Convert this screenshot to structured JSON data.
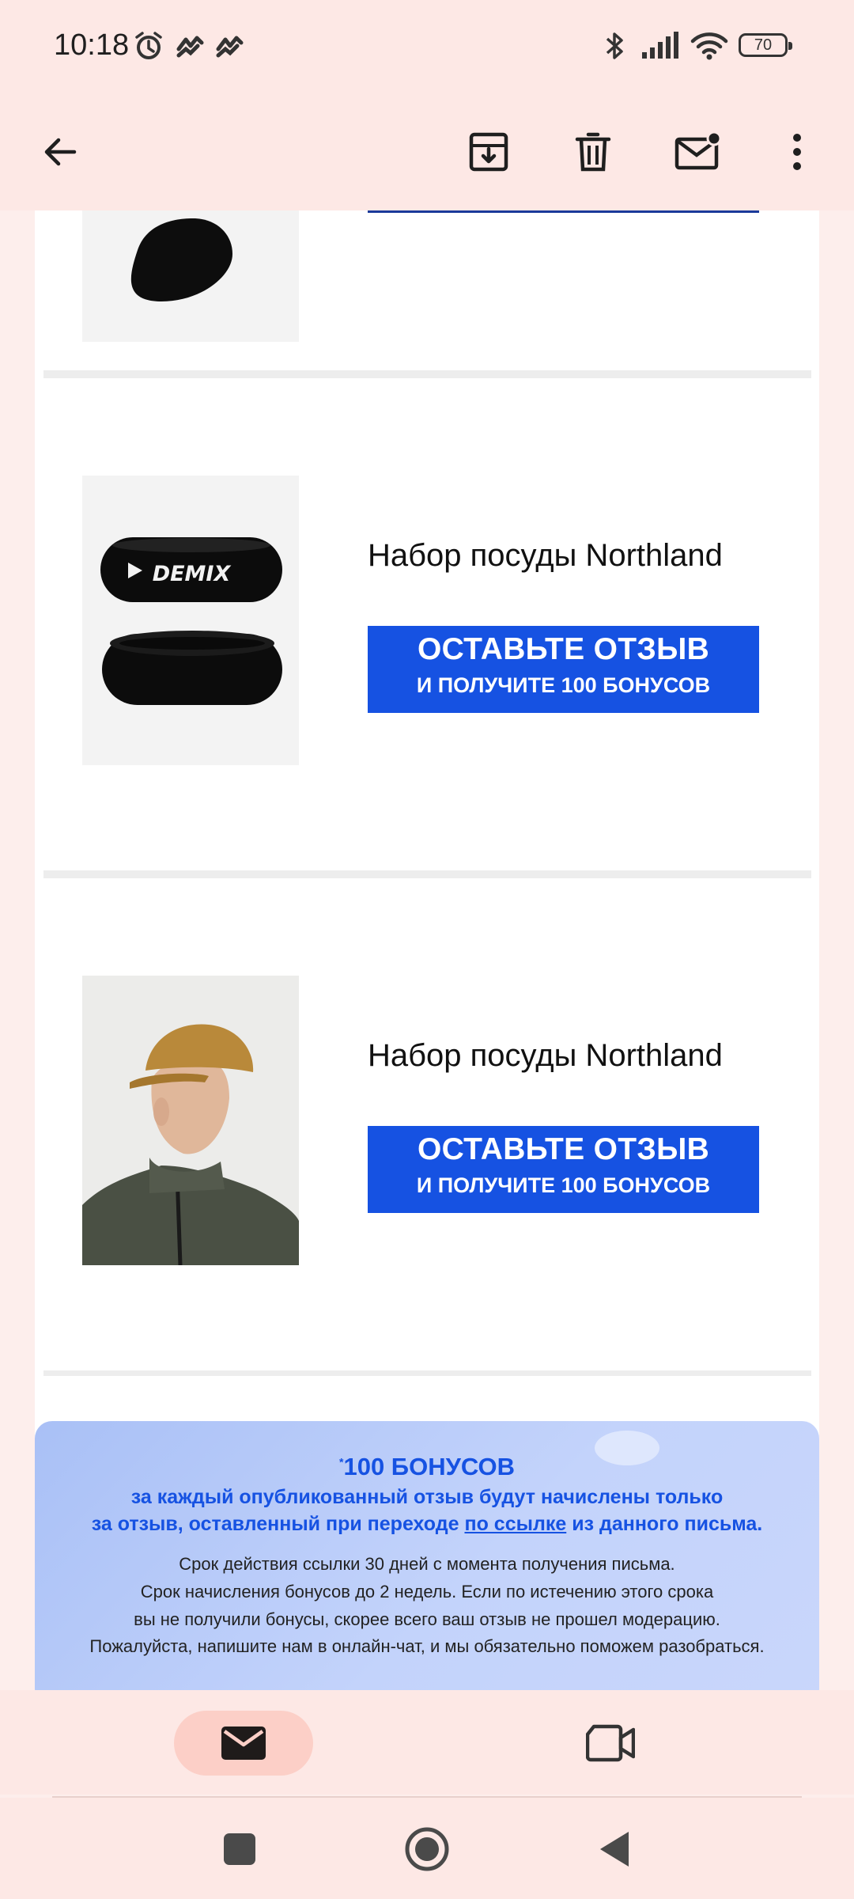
{
  "status_bar": {
    "time": "10:18",
    "battery": "70",
    "icons": [
      "alarm-icon",
      "app-notification-icon",
      "app-notification-icon",
      "bluetooth-icon",
      "signal-icon",
      "wifi-icon",
      "battery-icon"
    ]
  },
  "toolbar": {
    "icons": [
      "back-arrow-icon",
      "archive-icon",
      "delete-icon",
      "mark-unread-icon",
      "more-vert-icon"
    ]
  },
  "email": {
    "products": [
      {
        "title": "Набор посуды Northland",
        "cta_line1": "ОСТАВЬТЕ ОТЗЫВ",
        "cta_line2": "И ПОЛУЧИТЕ 100 БОНУСОВ",
        "image_brand": "DEMIX"
      },
      {
        "title": "Набор посуды Northland",
        "cta_line1": "ОСТАВЬТЕ ОТЗЫВ",
        "cta_line2": "И ПОЛУЧИТЕ 100 БОНУСОВ"
      }
    ],
    "bonus_info": {
      "title_mark": "*",
      "title": "100 БОНУСОВ",
      "line1": "за каждый опубликованный отзыв будут начислены только",
      "line2_prefix": "за отзыв, оставленный при переходе",
      "line2_link": "по ссылке",
      "line2_suffix": "из данного письма.",
      "small1": "Срок действия ссылки 30 дней с момента получения письма.",
      "small2": "Срок начисления бонусов до 2 недель. Если по истечению этого срока",
      "small3": "вы не получили бонусы, скорее всего ваш отзыв не прошел модерацию.",
      "small4": "Пожалуйста, напишите нам в онлайн-чат, и мы обязательно поможем разобраться."
    }
  },
  "bottom_nav": {
    "items": [
      "mail-icon",
      "video-icon"
    ],
    "active": "mail-icon"
  },
  "system_nav": {
    "items": [
      "recents-square-icon",
      "home-circle-icon",
      "back-triangle-icon"
    ]
  },
  "colors": {
    "accent_blue": "#1652e2",
    "chrome_background": "#fde8e5",
    "active_pill": "#fccfc7"
  }
}
